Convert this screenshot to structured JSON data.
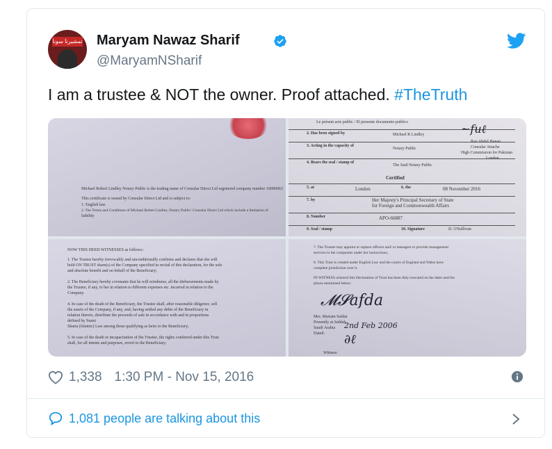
{
  "author": {
    "name": "Maryam Nawaz Sharif",
    "handle": "@MaryamNSharif",
    "avatar_text": "تمشيرنا سونا"
  },
  "tweet": {
    "text_main": "I am a trustee & NOT the owner. Proof attached. ",
    "hashtag": "#TheTruth"
  },
  "photos": {
    "p1": {
      "line1": "Michael Robert Lindley Notary Public is the trading name of Consular Direct Ltd registered company number 10096063",
      "line2": "This certificate is issued by Consular Direct Ltd and is subject to:",
      "line3": "1.       English law.",
      "line4": "2.       The Terms and Conditions of Michael Robert Lindley, Notary Public/ Consular Direct Ltd which include a limitation of",
      "line5": "liability"
    },
    "p2": {
      "header": "Le présent acte public / El presente documento publico",
      "r2_label": "2.   Has been signed by",
      "r2_value": "Michael R Lindley",
      "r3_label": "3.   Acting in the capacity of",
      "r3_value": "Notary Public",
      "r4_label": "4.   Bears the seal / stamp of",
      "r4_value": "The Said Notary Public",
      "certified": "Certified",
      "r5_label": "5.   at",
      "r5_value": "London",
      "r6_label": "6.   the",
      "r6_value": "08 November 2016",
      "r7_label": "7.   by",
      "r7_value1": "Her Majesty's Principal Secretary of State",
      "r7_value2": "for Foreign and Commonwealth Affairs",
      "r8_label": "8.   Number",
      "r8_value": "APO-66887",
      "r9_label": "9.   Seal / stamp",
      "r10_label": "10.  Signature",
      "r10_value": "D. O'Sullivan",
      "attache1": "Rao Abdul Hanan",
      "attache2": "Consular Attache",
      "attache3": "High Commission for Pakistan",
      "attache4": "London"
    },
    "p3": {
      "line1": "NOW THIS DEED WITNESSES as follows:-",
      "line2": "1. The Trustee hereby irrevocably and unconditionally confirms and declares that she will",
      "line3": "hold ON TRUST share(s) of the Company specified in recital of this declaration, for the sole",
      "line4": "and absolute benefit and on behalf of the Beneficiary;",
      "line5": "2. The Beneficiary hereby covenants that he will reimburse, all the disbursements made by",
      "line6": "the Trustee, if any, to her in relation to different expenses etc. incurred in relation to the",
      "line7": "Company.",
      "line8": "4. In case of the death of the Beneficiary, the Trustee shall, after reasonable diligence, sell",
      "line9": "the assets of the Company, if any, and, having settled any debts of the Beneficiary in",
      "line10": "relation thereto, distribute the proceeds of sale in accordance with and in proportions",
      "line11": "defined by Sunni",
      "line12": "Sharia (Islamic) Law among those qualifying as heirs to the Beneficiary;",
      "line13": "5. In case of the death or incapacitation of the Trustee, the rights conferred under this Trust",
      "line14": "shall, for all intents and purposes, revert to the Beneficiary;"
    },
    "p4": {
      "line1": "7. The Trustee may appoint or replace officers and/ or managers to provide management",
      "line2": "services to the companies under her instructions;",
      "line3": "8. This Trust is created under English Law and the courts of England and Wales have",
      "line4": "complete jurisdiction over it.",
      "line5": "IN WITNESS whereof this Declaration of Trust has been duly executed on the dates and the",
      "line6": "places mentioned below:",
      "line7": "Mrs. Mariam Safdar",
      "line8": "Presently at Jeddah,",
      "line9": "Saudi Arabia",
      "line10": "Dated:",
      "handwritten_date": "2nd Feb 2006",
      "line11": "Witness:"
    }
  },
  "footer": {
    "likes": "1,338",
    "timestamp": "1:30 PM - Nov 15, 2016",
    "talking": "1,081 people are talking about this"
  },
  "colors": {
    "accent": "#1b95e0",
    "muted": "#657786",
    "verified": "#1da1f2",
    "text": "#14171a"
  },
  "icons": [
    "verified-badge-icon",
    "twitter-bird-icon",
    "heart-icon",
    "info-icon",
    "speech-bubble-icon",
    "chevron-right-icon"
  ]
}
